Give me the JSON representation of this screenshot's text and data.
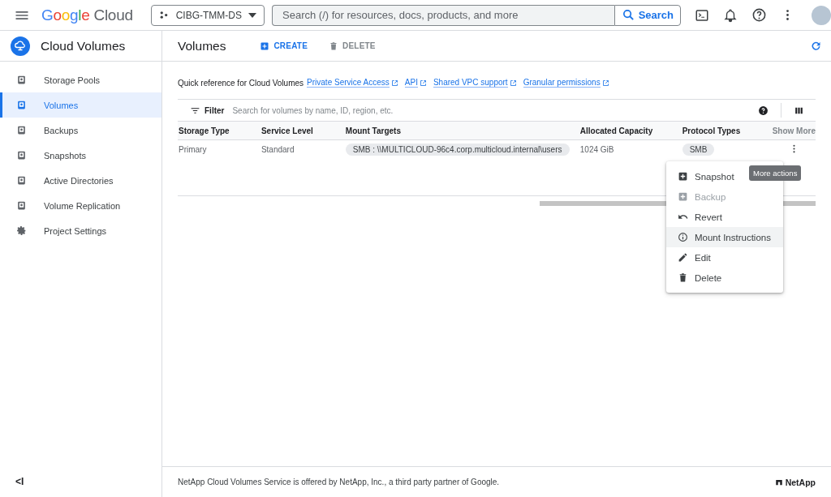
{
  "topbar": {
    "logo": {
      "brand": "Google",
      "product": "Cloud"
    },
    "project": "CIBG-TMM-DS",
    "search": {
      "placeholder": "Search (/) for resources, docs, products, and more",
      "button": "Search"
    }
  },
  "sidebar": {
    "title": "Cloud Volumes",
    "items": [
      {
        "label": "Storage Pools",
        "selected": false
      },
      {
        "label": "Volumes",
        "selected": true
      },
      {
        "label": "Backups",
        "selected": false
      },
      {
        "label": "Snapshots",
        "selected": false
      },
      {
        "label": "Active Directories",
        "selected": false
      },
      {
        "label": "Volume Replication",
        "selected": false
      },
      {
        "label": "Project Settings",
        "selected": false
      }
    ],
    "collapse": "<I"
  },
  "page": {
    "title": "Volumes",
    "actions": [
      {
        "label": "CREATE",
        "disabled": false
      },
      {
        "label": "DELETE",
        "disabled": true
      }
    ]
  },
  "quick_reference": {
    "text": "Quick reference for Cloud Volumes",
    "links": [
      "Private Service Access",
      "API",
      "Shared VPC support",
      "Granular permissions"
    ]
  },
  "filter": {
    "label": "Filter",
    "placeholder": "Search for volumes by name, ID, region, etc."
  },
  "table": {
    "columns": [
      {
        "label": "Storage Type",
        "kind": "text"
      },
      {
        "label": "Service Level",
        "kind": "text"
      },
      {
        "label": "Mount Targets",
        "kind": "chip"
      },
      {
        "label": "Allocated Capacity",
        "kind": "text"
      },
      {
        "label": "Protocol Types",
        "kind": "chip"
      }
    ],
    "show_more": "Show More",
    "rows": [
      {
        "cells": [
          "Primary",
          "Standard",
          "SMB : \\\\MULTICLOUD-96c4.corp.multicloud.internal\\users",
          "1024 GiB",
          "SMB"
        ]
      }
    ]
  },
  "actions_menu": {
    "tooltip": "More actions",
    "items": [
      {
        "label": "Snapshot",
        "disabled": false,
        "selected": false
      },
      {
        "label": "Backup",
        "disabled": true,
        "selected": false
      },
      {
        "label": "Revert",
        "disabled": false,
        "selected": false
      },
      {
        "label": "Mount Instructions",
        "disabled": false,
        "selected": true
      },
      {
        "label": "Edit",
        "disabled": false,
        "selected": false
      },
      {
        "label": "Delete",
        "disabled": false,
        "selected": false
      }
    ]
  },
  "footer": {
    "text": "NetApp Cloud Volumes Service is offered by NetApp, Inc., a third party partner of Google.",
    "brand": "NetApp"
  }
}
